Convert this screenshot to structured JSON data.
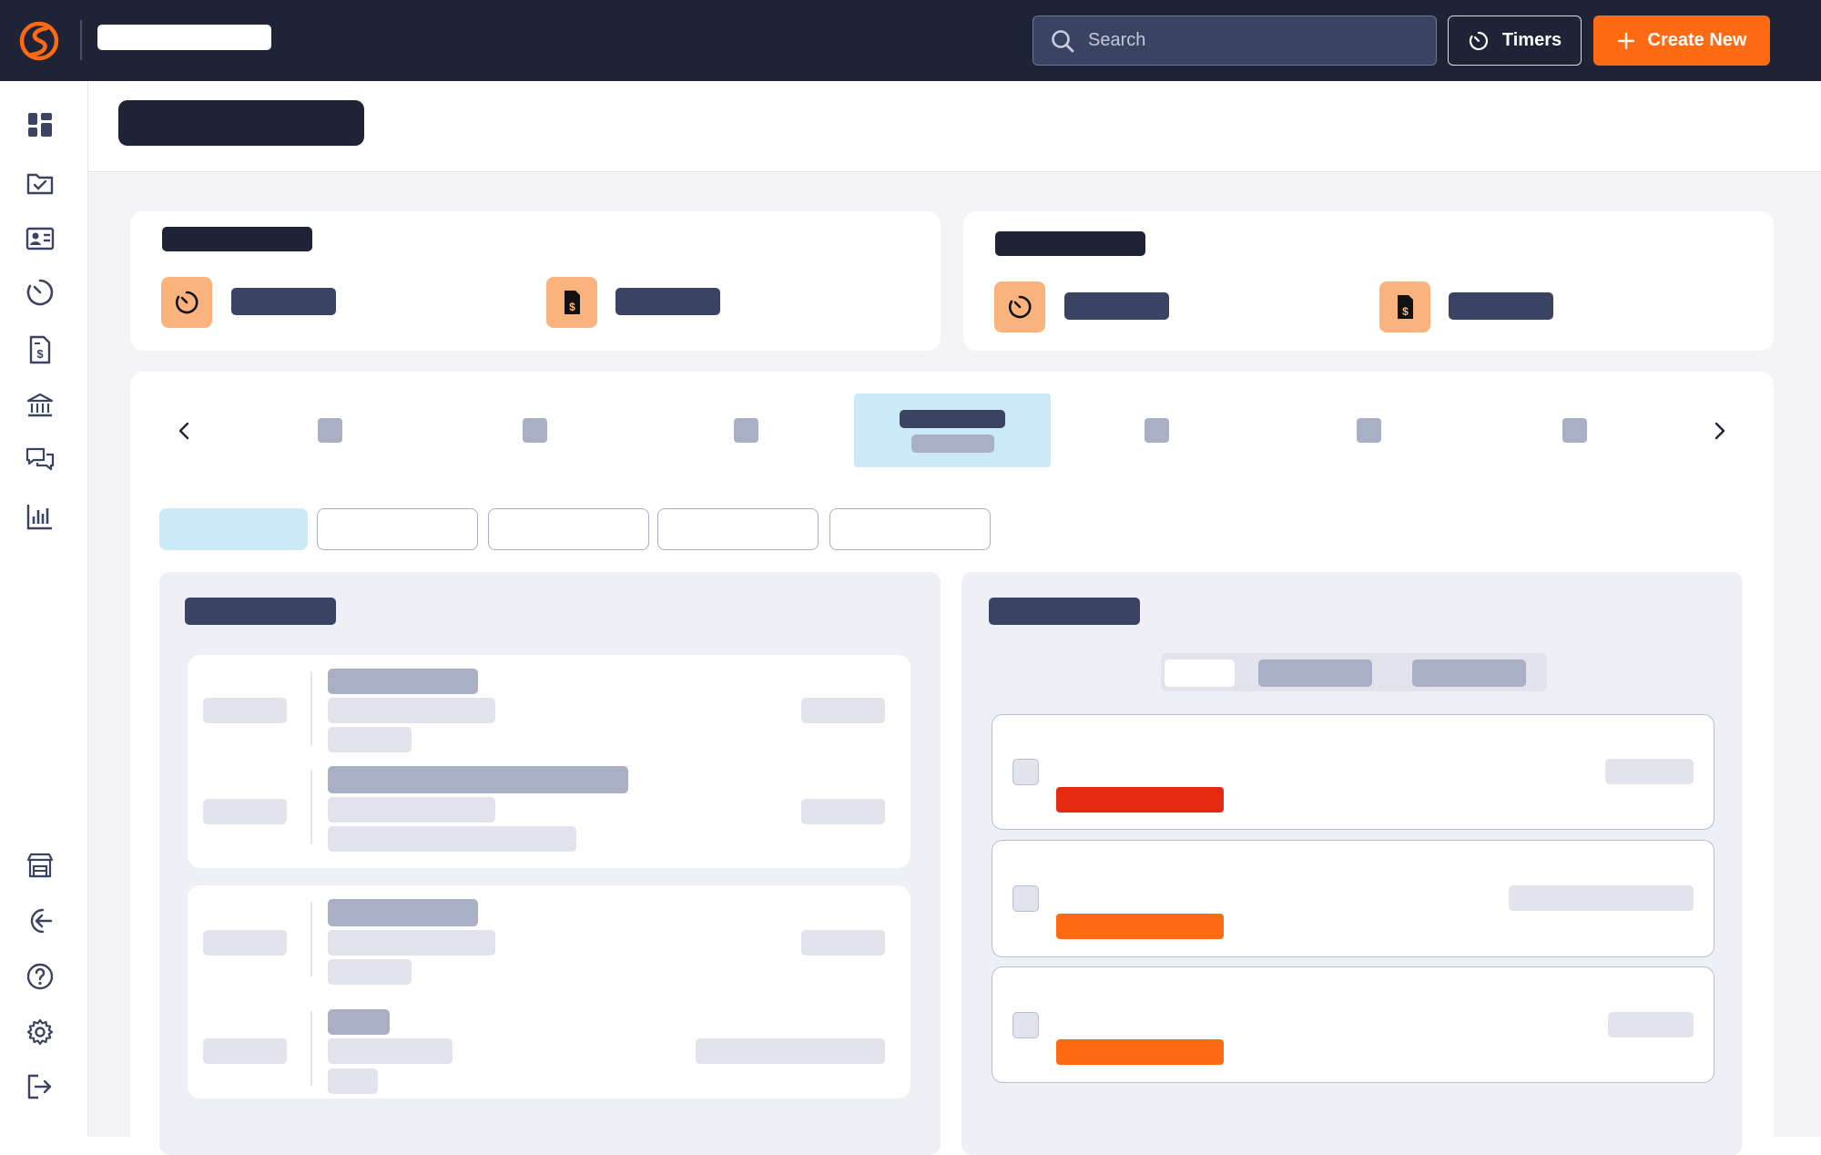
{
  "header": {
    "search": {
      "placeholder": "Search"
    },
    "timers_label": "Timers",
    "create_label": "Create New",
    "colors": {
      "bar": "#1e2336",
      "accent": "#ff6a13"
    }
  },
  "sidebar": {
    "top_icons": [
      "dashboard-icon",
      "tasks-icon",
      "contacts-icon",
      "timer-icon",
      "invoice-icon",
      "bank-icon",
      "chat-icon",
      "reports-icon"
    ],
    "bottom_icons": [
      "store-icon",
      "back-icon",
      "help-icon",
      "settings-icon",
      "logout-icon"
    ]
  },
  "week_nav": {
    "days_count": 7,
    "active_index": 3
  },
  "filter_tabs": {
    "count": 5,
    "active_index": 0
  },
  "task_panel": {
    "segments": 3,
    "tasks": [
      {
        "tag_color": "#e62a12"
      },
      {
        "tag_color": "#ff6a13"
      },
      {
        "tag_color": "#ff6a13"
      }
    ]
  }
}
